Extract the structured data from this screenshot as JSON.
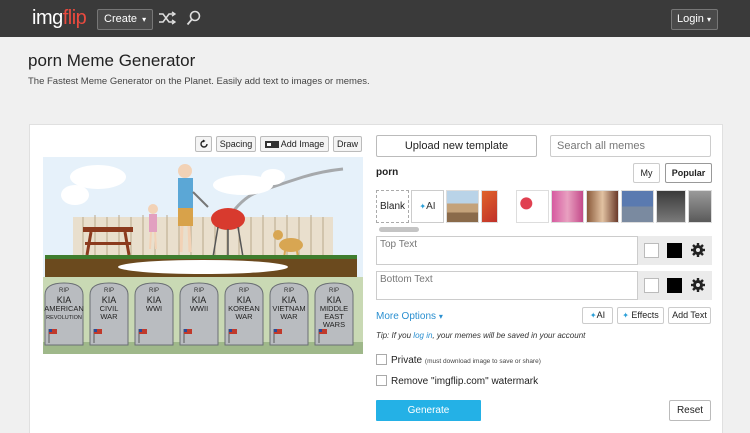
{
  "nav": {
    "logo_img": "img",
    "logo_flip": "flip",
    "create_label": "Create",
    "login_label": "Login",
    "caret": "▾"
  },
  "header": {
    "title": "porn Meme Generator",
    "subtitle": "The Fastest Meme Generator on the Planet. Easily add text to images or memes."
  },
  "editor_toolbar": {
    "spacing_label": "Spacing",
    "add_image_label": "Add Image",
    "draw_label": "Draw"
  },
  "meme_image": {
    "tombstones": [
      {
        "rip": "RIP",
        "text": "KIA\nAMERICAN\nREVOLUTION"
      },
      {
        "rip": "RIP",
        "text": "KIA\nCIVIL\nWAR"
      },
      {
        "rip": "RIP",
        "text": "KIA\nWWI"
      },
      {
        "rip": "RIP",
        "text": "KIA\nWWII"
      },
      {
        "rip": "RIP",
        "text": "KIA\nKOREAN\nWAR"
      },
      {
        "rip": "RIP",
        "text": "KIA\nVIETNAM\nWAR"
      },
      {
        "rip": "RIP",
        "text": "KIA\nMIDDLE\nEAST\nWARS"
      }
    ]
  },
  "template_panel": {
    "upload_label": "Upload new template",
    "search_placeholder": "Search all memes",
    "query": "porn",
    "tab_my": "My",
    "tab_popular": "Popular",
    "blank_label": "Blank",
    "ai_label": "AI",
    "ai_spark": "✦"
  },
  "text_boxes": [
    {
      "placeholder": "Top Text",
      "color": "#ffffff",
      "outline": "#000000"
    },
    {
      "placeholder": "Bottom Text",
      "color": "#ffffff",
      "outline": "#000000"
    }
  ],
  "options": {
    "more_options_label": "More Options",
    "ai_label": "AI",
    "effects_label": "Effects",
    "add_text_label": "Add Text"
  },
  "tip": {
    "prefix": "Tip: If you",
    "link": "log in",
    "suffix": ", your memes will be saved in your account"
  },
  "checkboxes": {
    "private_label": "Private",
    "private_hint": "(must download image to save or share)",
    "watermark_label": "Remove \"imgflip.com\" watermark"
  },
  "actions": {
    "generate_label": "Generate",
    "reset_label": "Reset"
  },
  "colors": {
    "brand_red": "#e94a3f",
    "accent_blue": "#24b1e6",
    "nav_bg": "#3a3a3a"
  }
}
